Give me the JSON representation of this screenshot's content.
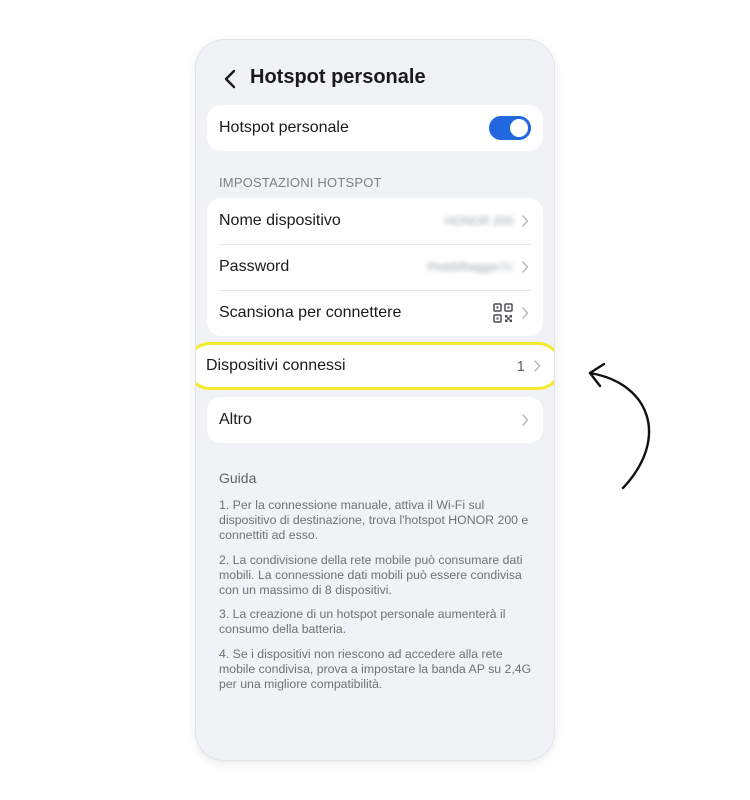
{
  "header": {
    "title": "Hotspot personale"
  },
  "hotspot_toggle": {
    "label": "Hotspot personale",
    "enabled": true,
    "accent": "#2167e0"
  },
  "settings_section": {
    "title": "IMPOSTAZIONI HOTSPOT",
    "items": [
      {
        "label": "Nome dispositivo",
        "value": "HONOR 200"
      },
      {
        "label": "Password",
        "value": "Pmb5Rwgger7c"
      },
      {
        "label": "Scansiona per connettere",
        "icon": "qr-code-icon"
      }
    ]
  },
  "connected_devices": {
    "label": "Dispositivi connessi",
    "count": "1",
    "highlight_color": "#f3ea2b"
  },
  "other": {
    "label": "Altro"
  },
  "guide": {
    "title": "Guida",
    "items": [
      "1. Per la connessione manuale, attiva il Wi-Fi sul dispositivo di destinazione, trova l'hotspot HONOR 200 e connettiti ad esso.",
      "2. La condivisione della rete mobile può consumare dati mobili. La connessione dati mobili può essere condivisa con un massimo di 8 dispositivi.",
      "3. La creazione di un hotspot personale aumenterà il consumo della batteria.",
      "4. Se i dispositivi non riescono ad accedere alla rete mobile condivisa, prova a impostare la banda AP su 2,4G per una migliore compatibilità."
    ]
  }
}
